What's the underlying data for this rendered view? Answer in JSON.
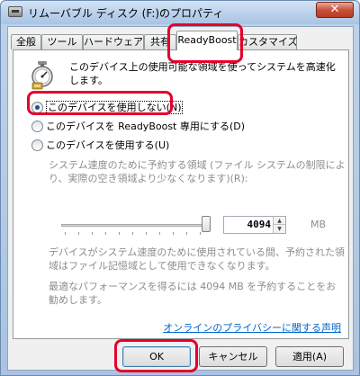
{
  "window": {
    "title": "リムーバブル ディスク (F:)のプロパティ",
    "close_glyph": "✕"
  },
  "tabs": [
    {
      "label": "全般"
    },
    {
      "label": "ツール"
    },
    {
      "label": "ハードウェア"
    },
    {
      "label": "共有"
    },
    {
      "label": "ReadyBoost",
      "active": true
    },
    {
      "label": "カスタマイズ"
    }
  ],
  "readyboost": {
    "icon": "readyboost-gauge-icon",
    "description": "このデバイス上の使用可能な領域を使ってシステムを高速化します。",
    "options": [
      {
        "label": "このデバイスを使用しない(N)",
        "selected": true
      },
      {
        "label": "このデバイスを ReadyBoost 専用にする(D)",
        "selected": false
      },
      {
        "label": "このデバイスを使用する(U)",
        "selected": false
      }
    ],
    "reserve_label": "システム速度のために予約する領域 (ファイル システムの制限により、実際の空き領域より少なくなります)(R):",
    "slider_value": 4094,
    "spin_value": "4094",
    "unit": "MB",
    "note": "デバイスがシステム速度のために使用されている間、予約された領域はファイル記憶域として使用できなくなります。",
    "recommend": "最適なパフォーマンスを得るには 4094 MB を予約することをお勧めします。",
    "privacy_link": "オンラインのプライバシーに関する声明"
  },
  "buttons": {
    "ok": "OK",
    "cancel": "キャンセル",
    "apply": "適用(A)"
  },
  "highlight_color": "#e4002b"
}
